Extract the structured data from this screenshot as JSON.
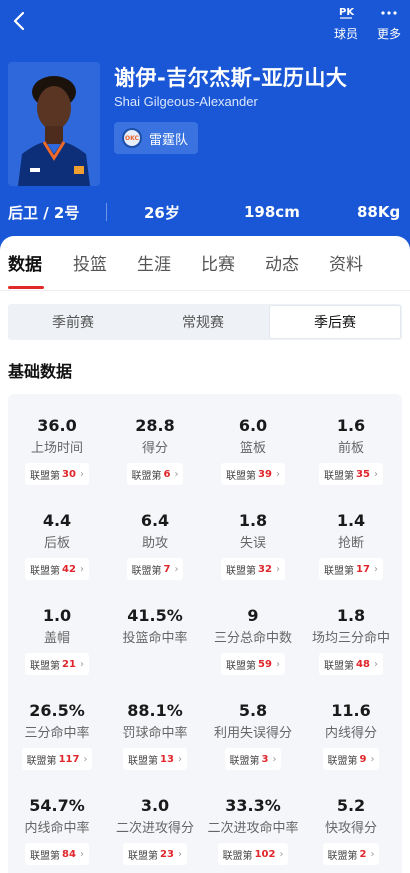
{
  "header": {
    "pk_label": "球员",
    "more_label": "更多",
    "pk_glyph": "PK",
    "icons": {
      "back": "chevron-left-icon",
      "pk": "pk-icon",
      "more": "more-dots-icon"
    }
  },
  "player": {
    "name_cn": "谢伊-吉尔杰斯-亚历山大",
    "name_en": "Shai Gilgeous-Alexander",
    "team": "雷霆队",
    "team_logo_text": "OKC",
    "position": "后卫 / 2号",
    "age": "26岁",
    "height": "198cm",
    "weight": "88Kg"
  },
  "tabs": [
    "数据",
    "投篮",
    "生涯",
    "比赛",
    "动态",
    "资料"
  ],
  "active_tab": "数据",
  "seasons": [
    "季前赛",
    "常规赛",
    "季后赛"
  ],
  "active_season": "季后赛",
  "section_title": "基础数据",
  "rank_prefix": "联盟第",
  "stats": [
    {
      "value": "36.0",
      "label": "上场时间",
      "rank": "30"
    },
    {
      "value": "28.8",
      "label": "得分",
      "rank": "6"
    },
    {
      "value": "6.0",
      "label": "篮板",
      "rank": "39"
    },
    {
      "value": "1.6",
      "label": "前板",
      "rank": "35"
    },
    {
      "value": "4.4",
      "label": "后板",
      "rank": "42"
    },
    {
      "value": "6.4",
      "label": "助攻",
      "rank": "7"
    },
    {
      "value": "1.8",
      "label": "失误",
      "rank": "32"
    },
    {
      "value": "1.4",
      "label": "抢断",
      "rank": "17"
    },
    {
      "value": "1.0",
      "label": "盖帽",
      "rank": "21"
    },
    {
      "value": "41.5%",
      "label": "投篮命中率",
      "rank": null
    },
    {
      "value": "9",
      "label": "三分总命中数",
      "rank": "59"
    },
    {
      "value": "1.8",
      "label": "场均三分命中",
      "rank": "48"
    },
    {
      "value": "26.5%",
      "label": "三分命中率",
      "rank": "117"
    },
    {
      "value": "88.1%",
      "label": "罚球命中率",
      "rank": "13"
    },
    {
      "value": "5.8",
      "label": "利用失误得分",
      "rank": "3"
    },
    {
      "value": "11.6",
      "label": "内线得分",
      "rank": "9"
    },
    {
      "value": "54.7%",
      "label": "内线命中率",
      "rank": "84"
    },
    {
      "value": "3.0",
      "label": "二次进攻得分",
      "rank": "23"
    },
    {
      "value": "33.3%",
      "label": "二次进攻命中率",
      "rank": "102"
    },
    {
      "value": "5.2",
      "label": "快攻得分",
      "rank": "2"
    }
  ],
  "colors": {
    "header_bg": "#1a57d6",
    "accent_red": "#e02a2a",
    "card_bg": "#f4f6fa"
  }
}
